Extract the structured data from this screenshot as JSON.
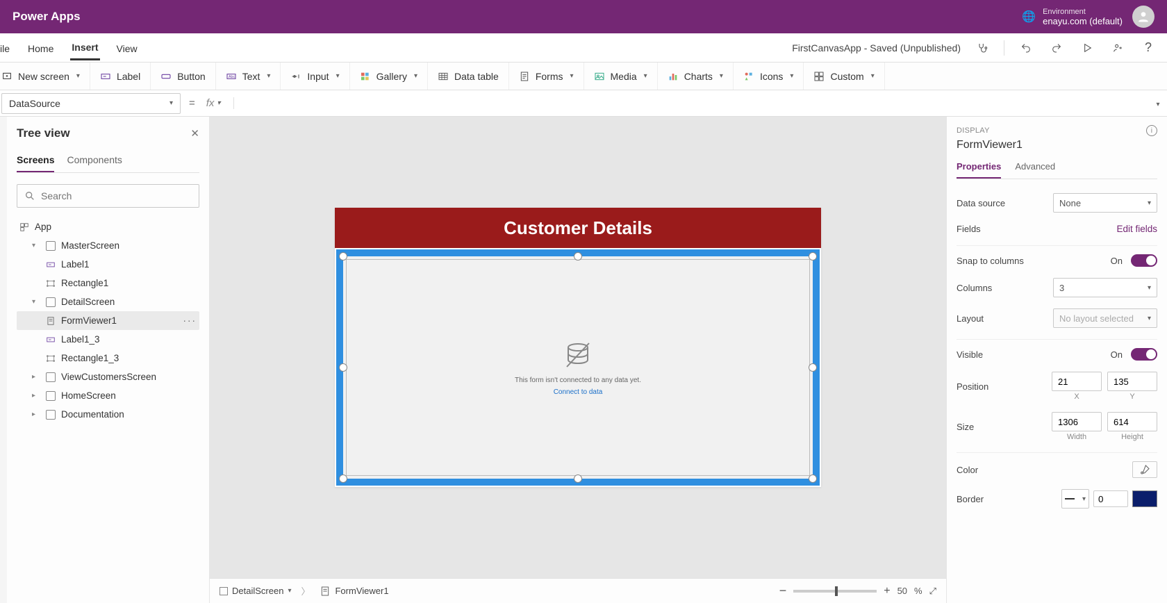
{
  "brand": "Power Apps",
  "environment": {
    "label": "Environment",
    "value": "enayu.com (default)"
  },
  "menu": {
    "tabs": [
      "ile",
      "Home",
      "Insert",
      "View"
    ],
    "active": 2,
    "appStatus": "FirstCanvasApp - Saved (Unpublished)"
  },
  "ribbon": {
    "newScreen": "New screen",
    "label": "Label",
    "button": "Button",
    "text": "Text",
    "input": "Input",
    "gallery": "Gallery",
    "dataTable": "Data table",
    "forms": "Forms",
    "media": "Media",
    "charts": "Charts",
    "icons": "Icons",
    "custom": "Custom"
  },
  "formula": {
    "property": "DataSource",
    "value": ""
  },
  "tree": {
    "title": "Tree view",
    "tabs": [
      "Screens",
      "Components"
    ],
    "activeTab": 0,
    "searchPlaceholder": "Search",
    "items": [
      {
        "type": "app",
        "label": "App",
        "indent": 0
      },
      {
        "type": "screen",
        "label": "MasterScreen",
        "indent": 0,
        "expanded": true
      },
      {
        "type": "ctrl",
        "label": "Label1",
        "indent": 1,
        "icon": "label"
      },
      {
        "type": "ctrl",
        "label": "Rectangle1",
        "indent": 1,
        "icon": "rect"
      },
      {
        "type": "screen",
        "label": "DetailScreen",
        "indent": 0,
        "expanded": true
      },
      {
        "type": "ctrl",
        "label": "FormViewer1",
        "indent": 1,
        "icon": "form",
        "selected": true,
        "more": true
      },
      {
        "type": "ctrl",
        "label": "Label1_3",
        "indent": 1,
        "icon": "label"
      },
      {
        "type": "ctrl",
        "label": "Rectangle1_3",
        "indent": 1,
        "icon": "rect"
      },
      {
        "type": "screen",
        "label": "ViewCustomersScreen",
        "indent": 0,
        "expanded": false
      },
      {
        "type": "screen",
        "label": "HomeScreen",
        "indent": 0,
        "expanded": false
      },
      {
        "type": "screen",
        "label": "Documentation",
        "indent": 0,
        "expanded": false
      }
    ]
  },
  "stage": {
    "title": "Customer Details",
    "emptyMsg": "This form isn't connected to any data yet.",
    "connect": "Connect to data"
  },
  "crumb": {
    "screen": "DetailScreen",
    "control": "FormViewer1",
    "zoom": "50",
    "pct": "%"
  },
  "props": {
    "caption": "DISPLAY",
    "name": "FormViewer1",
    "tabs": [
      "Properties",
      "Advanced"
    ],
    "activeTab": 0,
    "dataSource": {
      "label": "Data source",
      "value": "None"
    },
    "fields": {
      "label": "Fields",
      "link": "Edit fields"
    },
    "snap": {
      "label": "Snap to columns",
      "on": "On"
    },
    "columns": {
      "label": "Columns",
      "value": "3"
    },
    "layout": {
      "label": "Layout",
      "value": "No layout selected"
    },
    "visible": {
      "label": "Visible",
      "on": "On"
    },
    "position": {
      "label": "Position",
      "x": "21",
      "y": "135",
      "xl": "X",
      "yl": "Y"
    },
    "size": {
      "label": "Size",
      "w": "1306",
      "h": "614",
      "wl": "Width",
      "hl": "Height"
    },
    "color": {
      "label": "Color"
    },
    "border": {
      "label": "Border",
      "width": "0"
    }
  }
}
